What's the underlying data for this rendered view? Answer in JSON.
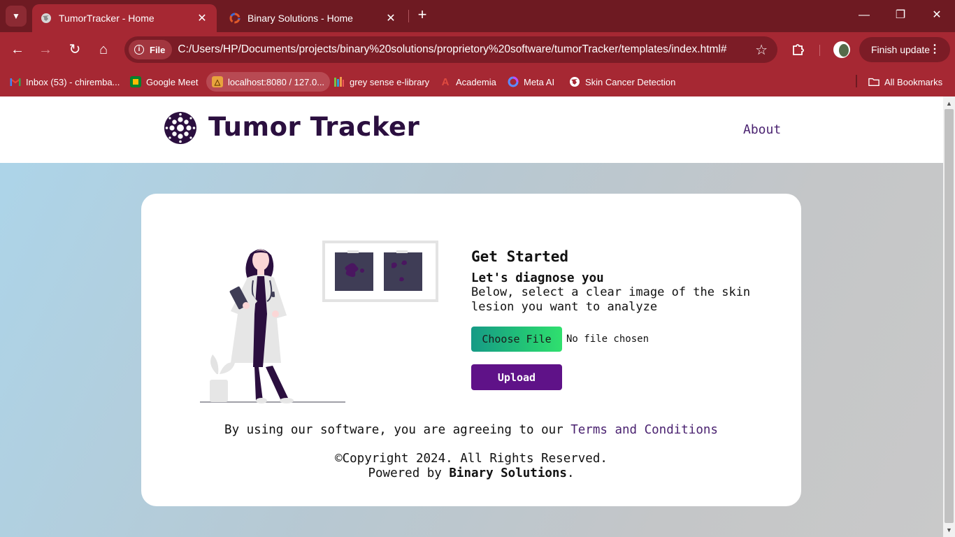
{
  "browser": {
    "tabs": [
      {
        "title": "TumorTracker - Home",
        "active": true
      },
      {
        "title": "Binary Solutions - Home",
        "active": false
      }
    ],
    "url_chip": "File",
    "url": "C:/Users/HP/Documents/projects/binary%20solutions/proprietory%20software/tumorTracker/templates/index.html#",
    "finish_update": "Finish update",
    "bookmarks": [
      {
        "label": "Inbox (53) - chiremba..."
      },
      {
        "label": "Google Meet"
      },
      {
        "label": "localhost:8080 / 127.0..."
      },
      {
        "label": "grey sense e-library"
      },
      {
        "label": "Academia"
      },
      {
        "label": "Meta AI"
      },
      {
        "label": "Skin Cancer Detection"
      }
    ],
    "all_bookmarks": "All Bookmarks",
    "colors": {
      "frame": "#6e1a22",
      "toolbar": "#a62833"
    }
  },
  "site": {
    "brand": "Tumor Tracker",
    "nav_about": "About",
    "heading": "Get Started",
    "subheading": "Let's diagnose you",
    "description": "Below, select a clear image of the skin lesion you want to analyze",
    "choose_file": "Choose File",
    "no_file": "No file chosen",
    "upload": "Upload",
    "terms_prefix": "By using our software, you are agreeing to our",
    "terms_link": "Terms and Conditions",
    "copyright": "©Copyright 2024. All Rights Reserved.",
    "powered_prefix": "Powered by",
    "powered_name": "Binary Solutions",
    "powered_suffix": ".",
    "colors": {
      "brand": "#2b0f3f",
      "accent": "#5f1288",
      "link": "#4a2270"
    }
  }
}
